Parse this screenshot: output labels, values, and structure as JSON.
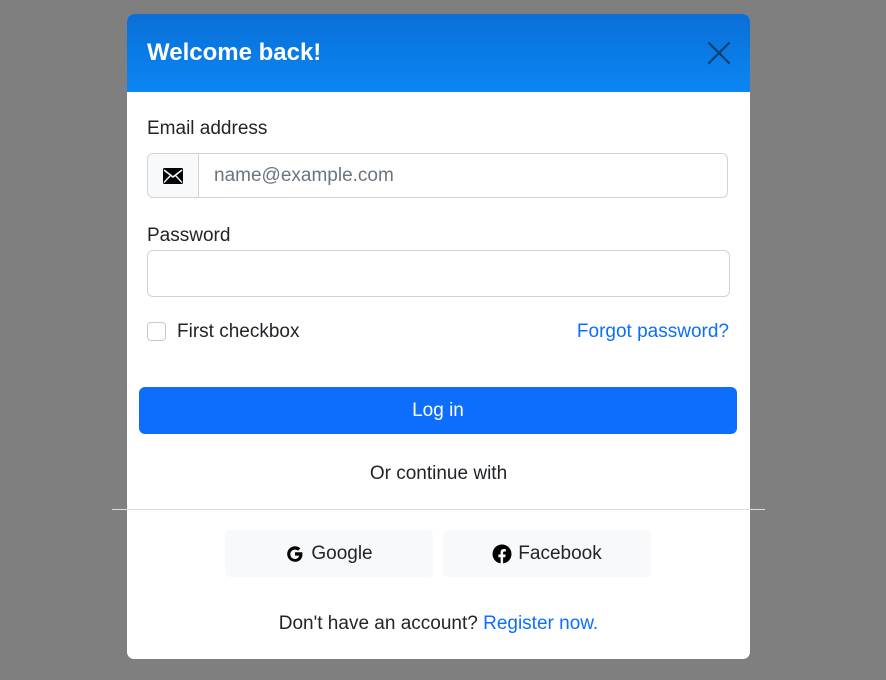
{
  "modal": {
    "title": "Welcome back!"
  },
  "form": {
    "email_label": "Email address",
    "email_placeholder": "name@example.com",
    "email_value": "",
    "password_label": "Password",
    "password_value": "",
    "checkbox_label": "First checkbox",
    "checkbox_checked": false,
    "forgot_link": "Forgot password?",
    "login_button": "Log in"
  },
  "social": {
    "divider_text": "Or continue with",
    "buttons": [
      {
        "label": "Google",
        "icon": "google-icon"
      },
      {
        "label": "Facebook",
        "icon": "facebook-icon"
      }
    ]
  },
  "footer": {
    "prompt": "Don't have an account?",
    "register_link": "Register now."
  },
  "colors": {
    "header_gradient_top": "#0a6fd6",
    "header_gradient_bottom": "#0b86f5",
    "primary": "#0d6efd",
    "backdrop": "#7f7f7f"
  }
}
